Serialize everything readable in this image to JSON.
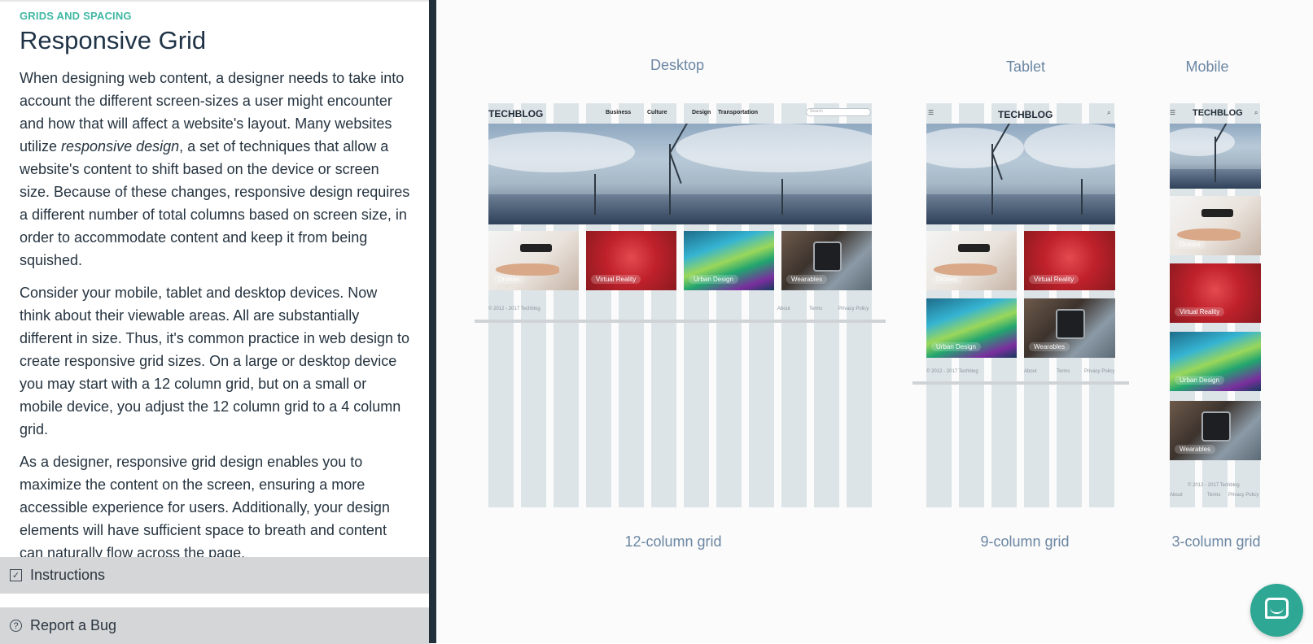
{
  "lesson": {
    "eyebrow": "GRIDS AND SPACING",
    "title": "Responsive Grid",
    "p1_a": "When designing web content, a designer needs to take into account the different screen-sizes a user might encounter and how that will affect a website's layout. Many websites utilize ",
    "p1_em": "responsive design",
    "p1_b": ", a set of techniques that allow a website's content to shift based on the device or screen size. Because of these changes, responsive design requires a different number of total columns based on screen size, in order to accommodate content and keep it from being squished.",
    "p2": "Consider your mobile, tablet and desktop devices. Now think about their viewable areas. All are substantially different in size. Thus, it's common practice in web design to create responsive grid sizes. On a large or desktop device you may start with a 12 column grid, but on a small or mobile device, you adjust the 12 column grid to a 4 column grid.",
    "p3": "As a designer, responsive grid design enables you to maximize the content on the screen, ensuring a more accessible experience for users. Additionally, your design elements will have sufficient space to breath and content can naturally flow across the page."
  },
  "panels": {
    "instructions": "Instructions",
    "report_bug": "Report a Bug"
  },
  "devices": {
    "desktop": {
      "label": "Desktop",
      "caption": "12-column grid"
    },
    "tablet": {
      "label": "Tablet",
      "caption": "9-column grid"
    },
    "mobile": {
      "label": "Mobile",
      "caption": "3-column grid"
    }
  },
  "mock": {
    "logo": "TECHBLOG",
    "nav": [
      "Business",
      "Culture",
      "Design",
      "Transportation"
    ],
    "search_placeholder": "Search",
    "tiles": [
      "Drones",
      "Virtual Reality",
      "Urban Design",
      "Wearables"
    ],
    "copyright": "© 2012 - 2017 Techblog",
    "footer_links": [
      "About",
      "Terms",
      "Privacy Policy"
    ]
  },
  "icons": {
    "instructions": "checkbox-icon",
    "report_bug": "question-circle-icon",
    "chat": "chat-bubble-icon"
  },
  "colors": {
    "accent": "#3fb8a4",
    "title": "#1f3347",
    "device_label": "#6b86a3",
    "chat_button": "#2ea894"
  }
}
